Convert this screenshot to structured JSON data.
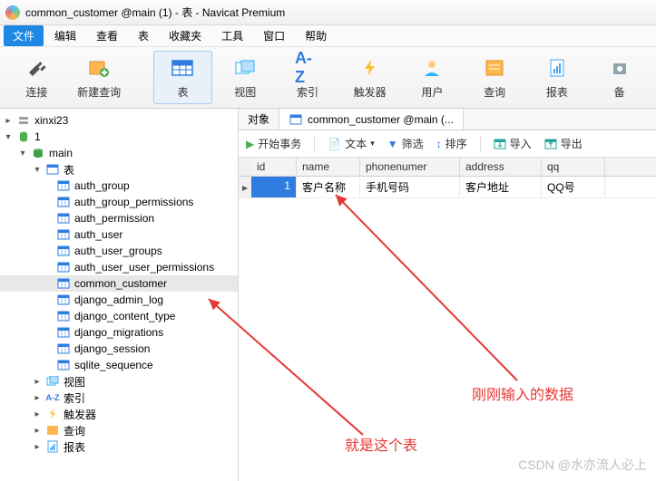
{
  "window": {
    "title": "common_customer @main (1) - 表 - Navicat Premium"
  },
  "menu": {
    "file": "文件",
    "items": [
      "编辑",
      "查看",
      "表",
      "收藏夹",
      "工具",
      "窗口",
      "帮助"
    ]
  },
  "toolbar": [
    {
      "key": "connect",
      "label": "连接"
    },
    {
      "key": "newquery",
      "label": "新建查询"
    },
    {
      "key": "table",
      "label": "表",
      "active": true
    },
    {
      "key": "view",
      "label": "视图"
    },
    {
      "key": "index",
      "label": "索引"
    },
    {
      "key": "trigger",
      "label": "触发器"
    },
    {
      "key": "user",
      "label": "用户"
    },
    {
      "key": "query",
      "label": "查询"
    },
    {
      "key": "report",
      "label": "报表"
    },
    {
      "key": "backup",
      "label": "备"
    }
  ],
  "tree": {
    "root": "xinxi23",
    "db": "1",
    "main": "main",
    "tables_label": "表",
    "tables": [
      "auth_group",
      "auth_group_permissions",
      "auth_permission",
      "auth_user",
      "auth_user_groups",
      "auth_user_user_permissions",
      "common_customer",
      "django_admin_log",
      "django_content_type",
      "django_migrations",
      "django_session",
      "sqlite_sequence"
    ],
    "selected": "common_customer",
    "views": "视图",
    "indexes": "索引",
    "triggers": "触发器",
    "queries": "查询",
    "reports": "报表"
  },
  "tabs": {
    "objects": "对象",
    "current": "common_customer @main (..."
  },
  "rtoolbar": {
    "begin_tx": "开始事务",
    "text": "文本",
    "filter": "筛选",
    "sort": "排序",
    "import": "导入",
    "export": "导出"
  },
  "grid": {
    "columns": [
      "id",
      "name",
      "phonenumer",
      "address",
      "qq"
    ],
    "widths": [
      50,
      70,
      110,
      90,
      70
    ],
    "rows": [
      {
        "id": "1",
        "name": "客户名称",
        "phonenumer": "手机号码",
        "address": "客户地址",
        "qq": "QQ号"
      }
    ]
  },
  "annotations": {
    "table": "就是这个表",
    "data": "刚刚输入的数据"
  },
  "watermark": "CSDN @水亦流人必上"
}
